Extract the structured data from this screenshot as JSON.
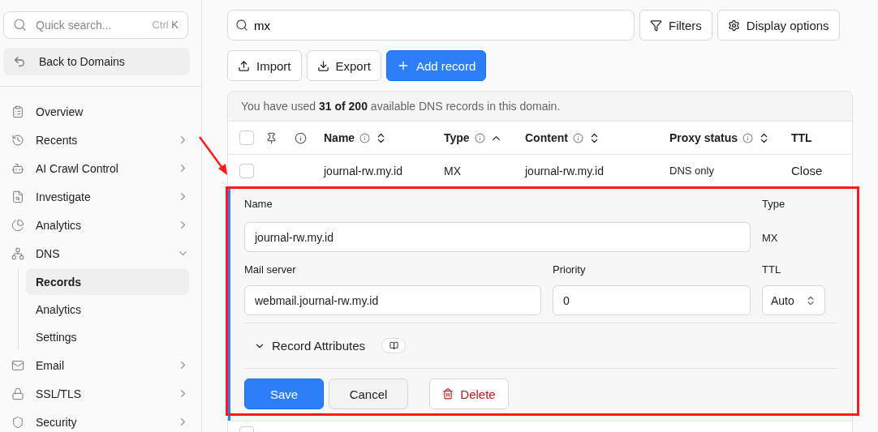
{
  "sidebar": {
    "search": {
      "placeholder": "Quick search...",
      "shortcut_modifier": "Ctrl",
      "shortcut_key": "K"
    },
    "back_button": "Back to Domains",
    "items": [
      {
        "label": "Overview",
        "expandable": false,
        "expanded": false,
        "selected": false
      },
      {
        "label": "Recents",
        "expandable": true,
        "expanded": false,
        "selected": false
      },
      {
        "label": "AI Crawl Control",
        "expandable": true,
        "expanded": false,
        "selected": false
      },
      {
        "label": "Investigate",
        "expandable": true,
        "expanded": false,
        "selected": false
      },
      {
        "label": "Analytics",
        "expandable": true,
        "expanded": false,
        "selected": false
      },
      {
        "label": "DNS",
        "expandable": true,
        "expanded": true,
        "selected": false,
        "children": [
          {
            "label": "Records",
            "selected": true
          },
          {
            "label": "Analytics",
            "selected": false
          },
          {
            "label": "Settings",
            "selected": false
          }
        ]
      },
      {
        "label": "Email",
        "expandable": true,
        "expanded": false,
        "selected": false
      },
      {
        "label": "SSL/TLS",
        "expandable": true,
        "expanded": false,
        "selected": false
      },
      {
        "label": "Security",
        "expandable": true,
        "expanded": false,
        "selected": false
      }
    ]
  },
  "toolbar": {
    "search_value": "mx",
    "filters": "Filters",
    "display_options": "Display options",
    "import": "Import",
    "export": "Export",
    "add_record": "Add record"
  },
  "usage_note": "You have used **31 of 200** available DNS records in this domain.",
  "table": {
    "select_all_checked": false,
    "columns": [
      {
        "label": "Name",
        "kind": "sortable"
      },
      {
        "label": "Type",
        "kind": "sorted"
      },
      {
        "label": "Content",
        "kind": "sortable"
      },
      {
        "label": "Proxy status",
        "kind": "sortable"
      },
      {
        "label": "TTL",
        "kind": "plain"
      }
    ],
    "rows": [
      {
        "checked": false,
        "name": "journal-rw.my.id",
        "type": "MX",
        "content": "journal-rw.my.id",
        "proxy_status": "DNS only",
        "action": "Close"
      }
    ],
    "partial_row": {
      "checked": false
    }
  },
  "editor": {
    "name_label": "Name",
    "name_value": "journal-rw.my.id",
    "type_label": "Type",
    "type_value": "MX",
    "mail_server_label": "Mail server",
    "mail_server_value": "webmail.journal-rw.my.id",
    "priority_label": "Priority",
    "priority_value": "0",
    "ttl_label": "TTL",
    "ttl_value": "Auto",
    "attributes_label": "Record Attributes",
    "attributes_expanded": false,
    "save": "Save",
    "cancel": "Cancel",
    "delete": "Delete"
  }
}
